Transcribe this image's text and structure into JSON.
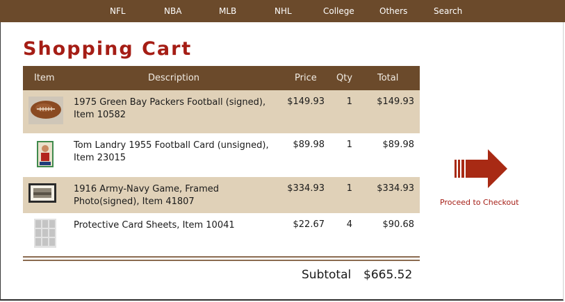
{
  "nav": {
    "items": [
      {
        "label": "NFL"
      },
      {
        "label": "NBA"
      },
      {
        "label": "MLB"
      },
      {
        "label": "NHL"
      },
      {
        "label": "College"
      },
      {
        "label": "Others"
      },
      {
        "label": "Search"
      }
    ]
  },
  "page": {
    "title": "Shopping Cart"
  },
  "cart": {
    "headers": {
      "item": "Item",
      "description": "Description",
      "price": "Price",
      "qty": "Qty",
      "total": "Total"
    },
    "rows": [
      {
        "description": "1975 Green Bay Packers Football (signed), Item 10582",
        "price": "$149.93",
        "qty": "1",
        "total": "$149.93",
        "thumb_icon": "football-photo"
      },
      {
        "description": "Tom Landry 1955 Football Card (unsigned), Item 23015",
        "price": "$89.98",
        "qty": "1",
        "total": "$89.98",
        "thumb_icon": "football-card-photo"
      },
      {
        "description": "1916 Army-Navy Game, Framed Photo(signed), Item 41807",
        "price": "$334.93",
        "qty": "1",
        "total": "$334.93",
        "thumb_icon": "framed-photo"
      },
      {
        "description": "Protective Card Sheets, Item 10041",
        "price": "$22.67",
        "qty": "4",
        "total": "$90.68",
        "thumb_icon": "card-sheets-photo"
      }
    ],
    "subtotal_label": "Subtotal",
    "subtotal_value": "$665.52"
  },
  "checkout": {
    "label": "Proceed to Checkout",
    "icon": "arrow-right-icon"
  },
  "colors": {
    "nav_bg": "#6b4a2b",
    "title": "#a51d15",
    "row_shade": "#e0d1b8",
    "arrow": "#a82a14"
  }
}
